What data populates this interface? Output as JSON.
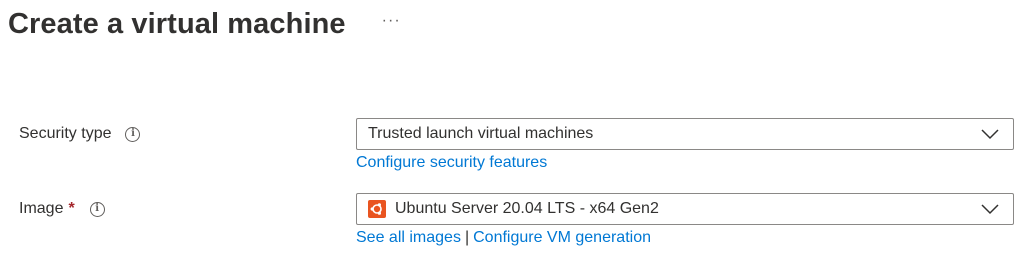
{
  "header": {
    "title": "Create a virtual machine",
    "more_label": "···"
  },
  "security_type": {
    "label": "Security type",
    "info_icon": "info-icon",
    "selected": "Trusted launch virtual machines",
    "link": "Configure security features"
  },
  "image": {
    "label": "Image",
    "required_mark": "*",
    "info_icon": "info-icon",
    "selected": "Ubuntu Server 20.04 LTS - x64 Gen2",
    "selected_icon": "ubuntu-logo-icon",
    "links": [
      "See all images",
      "Configure VM generation"
    ],
    "separator": "|"
  },
  "colors": {
    "link": "#0078d4",
    "required": "#a4262c",
    "ubuntu": "#e95420",
    "border": "#8a8886"
  }
}
